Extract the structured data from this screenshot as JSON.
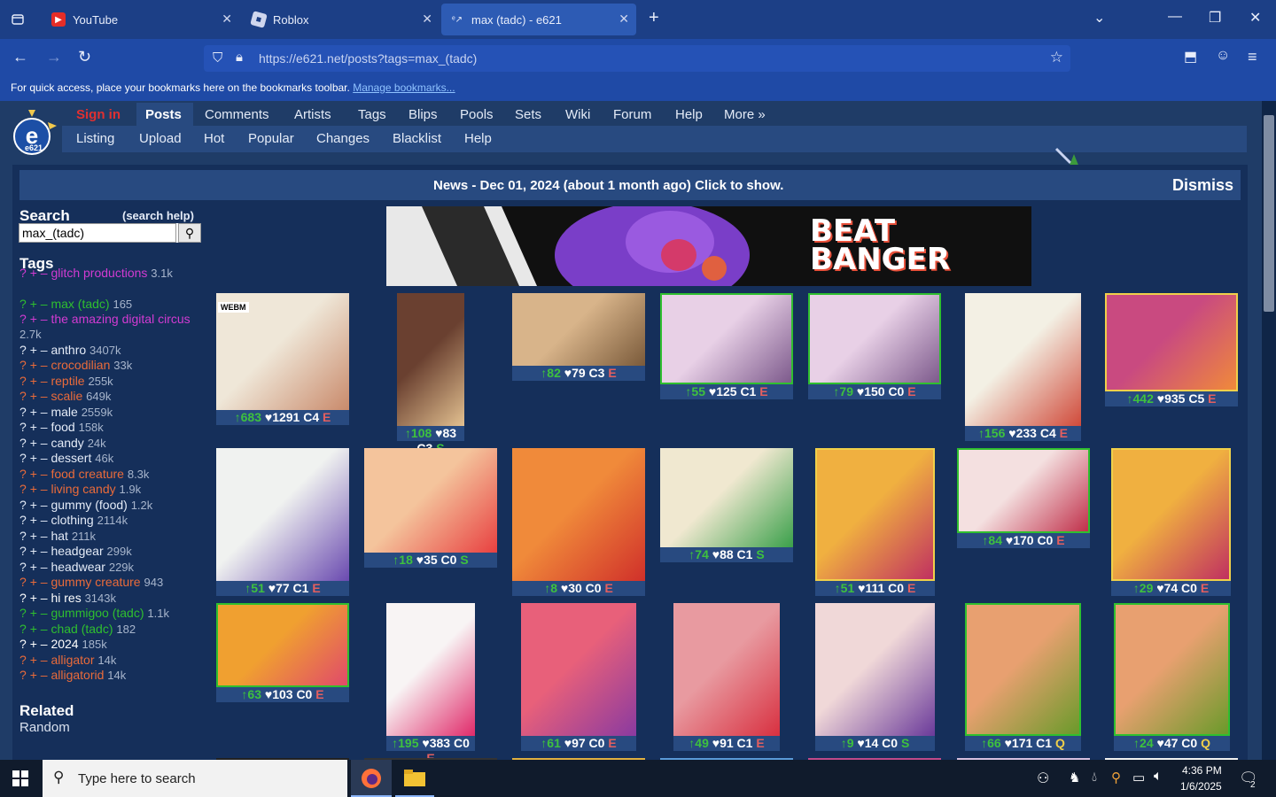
{
  "tabs": [
    {
      "title": "YouTube",
      "active": false
    },
    {
      "title": "Roblox",
      "active": false
    },
    {
      "title": "max (tadc) - e621",
      "active": true
    }
  ],
  "url": "https://e621.net/posts?tags=max_(tadc)",
  "bookmarks_msg": "For quick access, place your bookmarks here on the bookmarks toolbar.",
  "bookmarks_link": "Manage bookmarks...",
  "site": {
    "logo_text": "e621",
    "top_nav": [
      "Sign in",
      "Posts",
      "Comments",
      "Artists",
      "Tags",
      "Blips",
      "Pools",
      "Sets",
      "Wiki",
      "Forum",
      "Help",
      "More »"
    ],
    "sub_nav": [
      "Listing",
      "Upload",
      "Hot",
      "Popular",
      "Changes",
      "Blacklist",
      "Help"
    ],
    "news": "News - Dec 01, 2024 (about 1 month ago) Click to show.",
    "dismiss": "Dismiss",
    "search_title": "Search",
    "search_help": "(search help)",
    "search_value": "max_(tadc)",
    "tags_title": "Tags",
    "related_title": "Related",
    "related_random": "Random",
    "banner_text_1": "BEAT",
    "banner_text_2": "BANGER"
  },
  "tags": [
    {
      "name": "glitch productions",
      "count": "3.1k",
      "color": "#d23bd2",
      "wrap": true
    },
    {
      "name": "max (tadc)",
      "count": "165",
      "color": "#2fbf2f"
    },
    {
      "name": "the amazing digital circus",
      "count": "2.7k",
      "color": "#d23bd2",
      "wrap": true
    },
    {
      "name": "anthro",
      "count": "3407k",
      "color": "#e4ebf7"
    },
    {
      "name": "crocodilian",
      "count": "33k",
      "color": "#ea6b3a"
    },
    {
      "name": "reptile",
      "count": "255k",
      "color": "#ea6b3a"
    },
    {
      "name": "scalie",
      "count": "649k",
      "color": "#ea6b3a"
    },
    {
      "name": "male",
      "count": "2559k",
      "color": "#e4ebf7"
    },
    {
      "name": "food",
      "count": "158k",
      "color": "#e4ebf7"
    },
    {
      "name": "candy",
      "count": "24k",
      "color": "#e4ebf7"
    },
    {
      "name": "dessert",
      "count": "46k",
      "color": "#e4ebf7"
    },
    {
      "name": "food creature",
      "count": "8.3k",
      "color": "#ea6b3a"
    },
    {
      "name": "living candy",
      "count": "1.9k",
      "color": "#ea6b3a"
    },
    {
      "name": "gummy (food)",
      "count": "1.2k",
      "color": "#e4ebf7"
    },
    {
      "name": "clothing",
      "count": "2114k",
      "color": "#e4ebf7"
    },
    {
      "name": "hat",
      "count": "211k",
      "color": "#e4ebf7"
    },
    {
      "name": "headgear",
      "count": "299k",
      "color": "#e4ebf7"
    },
    {
      "name": "headwear",
      "count": "229k",
      "color": "#e4ebf7"
    },
    {
      "name": "gummy creature",
      "count": "943",
      "color": "#ea6b3a"
    },
    {
      "name": "hi res",
      "count": "3143k",
      "color": "#ffffff"
    },
    {
      "name": "gummigoo (tadc)",
      "count": "1.1k",
      "color": "#2fbf2f"
    },
    {
      "name": "chad (tadc)",
      "count": "182",
      "color": "#2fbf2f"
    },
    {
      "name": "2024",
      "count": "185k",
      "color": "#ffffff"
    },
    {
      "name": "alligator",
      "count": "14k",
      "color": "#ea6b3a"
    },
    {
      "name": "alligatorid",
      "count": "14k",
      "color": "#ea6b3a"
    }
  ],
  "posts": [
    {
      "up": "683",
      "fav": "1291",
      "c": "C4",
      "r": "E",
      "webm": true,
      "c1": "#efe7d8",
      "c2": "#c98a6b"
    },
    {
      "up": "108",
      "fav": "83",
      "c": "C3",
      "r": "S",
      "c1": "#6a4030",
      "c2": "#e2c090"
    },
    {
      "up": "82",
      "fav": "79",
      "c": "C3",
      "r": "E",
      "c1": "#d8b48a",
      "c2": "#7a5a3a"
    },
    {
      "up": "55",
      "fav": "125",
      "c": "C1",
      "r": "E",
      "c1": "#e8d0e6",
      "c2": "#7d5a8c"
    },
    {
      "up": "79",
      "fav": "150",
      "c": "C0",
      "r": "E",
      "c1": "#e8d0e6",
      "c2": "#7d5a8c"
    },
    {
      "up": "156",
      "fav": "233",
      "c": "C4",
      "r": "E",
      "c1": "#f3f0e4",
      "c2": "#d04a3a"
    },
    {
      "up": "442",
      "fav": "935",
      "c": "C5",
      "r": "E",
      "c1": "#c94a80",
      "c2": "#f08a3a"
    },
    {
      "up": "51",
      "fav": "77",
      "c": "C1",
      "r": "E",
      "c1": "#f0f2f0",
      "c2": "#6a4ab0"
    },
    {
      "up": "18",
      "fav": "35",
      "c": "C0",
      "r": "S",
      "c1": "#f4c49c",
      "c2": "#e84040"
    },
    {
      "up": "8",
      "fav": "30",
      "c": "C0",
      "r": "E",
      "c1": "#f08a3a",
      "c2": "#d0302a"
    },
    {
      "up": "74",
      "fav": "88",
      "c": "C1",
      "r": "S",
      "c1": "#f0e8d0",
      "c2": "#3aa04a"
    },
    {
      "up": "51",
      "fav": "111",
      "c": "C0",
      "r": "E",
      "c1": "#f0b040",
      "c2": "#c03060"
    },
    {
      "up": "84",
      "fav": "170",
      "c": "C0",
      "r": "E",
      "c1": "#f4e0e0",
      "c2": "#c0304a"
    },
    {
      "up": "29",
      "fav": "74",
      "c": "C0",
      "r": "E",
      "c1": "#f0b040",
      "c2": "#c03060"
    },
    {
      "up": "63",
      "fav": "103",
      "c": "C0",
      "r": "E",
      "c1": "#f0a030",
      "c2": "#e04a6a"
    },
    {
      "up": "195",
      "fav": "383",
      "c": "C0",
      "r": "E",
      "c1": "#f8f4f4",
      "c2": "#e02a6a"
    },
    {
      "up": "61",
      "fav": "97",
      "c": "C0",
      "r": "E",
      "c1": "#e8607a",
      "c2": "#8a3aa0"
    },
    {
      "up": "49",
      "fav": "91",
      "c": "C1",
      "r": "E",
      "c1": "#e89aa0",
      "c2": "#d83040"
    },
    {
      "up": "9",
      "fav": "14",
      "c": "C0",
      "r": "S",
      "c1": "#f0d8d8",
      "c2": "#6a3a9a"
    },
    {
      "up": "66",
      "fav": "171",
      "c": "C1",
      "r": "Q",
      "c1": "#e8a070",
      "c2": "#6a9a2a"
    },
    {
      "up": "24",
      "fav": "47",
      "c": "C0",
      "r": "Q",
      "c1": "#e8a070",
      "c2": "#6a9a2a"
    }
  ],
  "taskbar": {
    "search": "Type here to search",
    "time": "4:36 PM",
    "date": "1/6/2025",
    "notif": "2"
  }
}
